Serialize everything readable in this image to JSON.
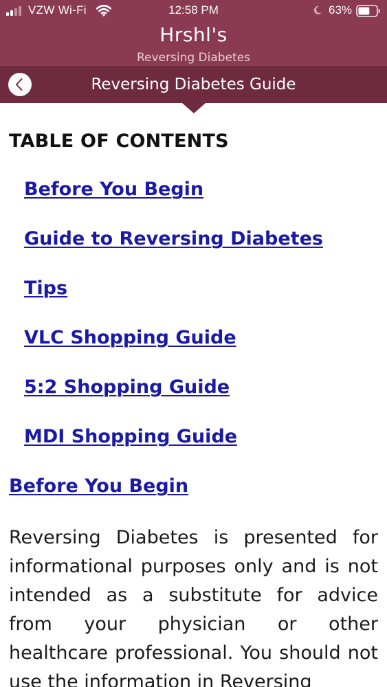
{
  "status_bar": {
    "carrier": "VZW Wi-Fi",
    "time": "12:58 PM",
    "battery_percent": "63%",
    "battery_level": 0.63,
    "signal_bars_active": 2,
    "icons": [
      "signal-icon",
      "wifi-icon",
      "moon-icon",
      "battery-icon"
    ]
  },
  "header": {
    "app_title": "Hrshl's",
    "app_subtitle": "Reversing Diabetes"
  },
  "nav": {
    "back_icon": "chevron-left-icon",
    "title": "Reversing Diabetes Guide"
  },
  "toc": {
    "heading": "TABLE OF CONTENTS",
    "items": [
      {
        "label": "Before You Begin"
      },
      {
        "label": "Guide to Reversing Diabetes"
      },
      {
        "label": "Tips"
      },
      {
        "label": "VLC Shopping Guide"
      },
      {
        "label": "5:2 Shopping Guide"
      },
      {
        "label": "MDI Shopping Guide"
      }
    ]
  },
  "section": {
    "title": "Before You Begin",
    "body": "Reversing Diabetes is presented for informational purposes only and is not intended as a substitute for advice from your physician or other healthcare professional. You should not use the information in Reversing"
  },
  "colors": {
    "header_bg": "#8a3a52",
    "nav_bg": "#6e2a3f",
    "link": "#1a1aa6"
  }
}
